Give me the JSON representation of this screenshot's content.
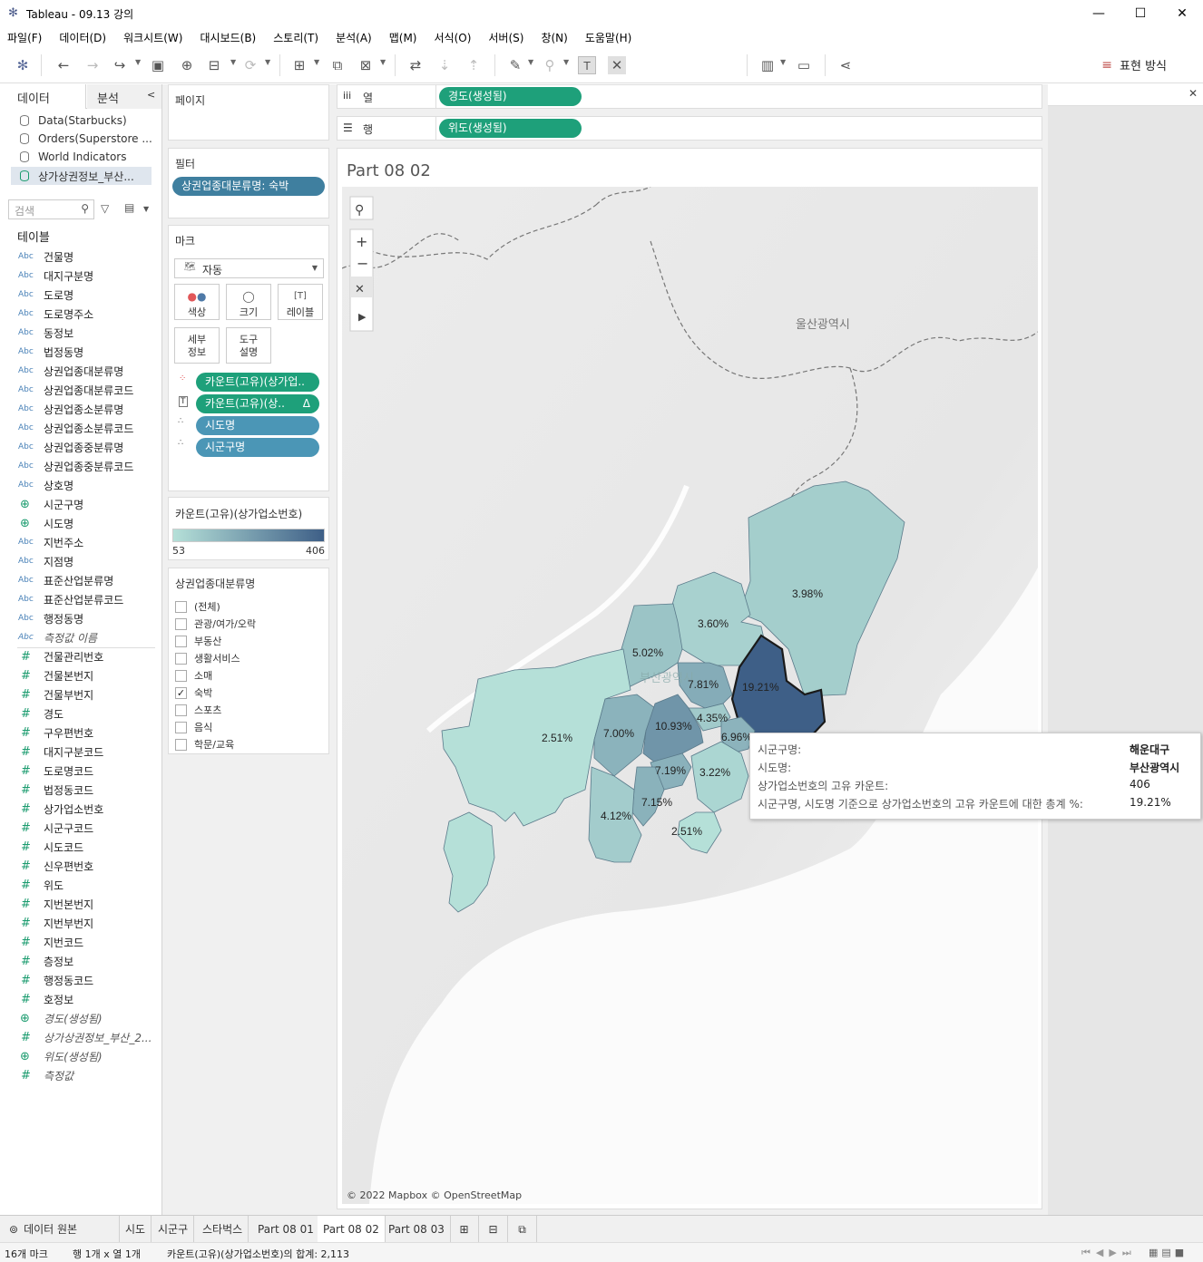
{
  "window": {
    "title": "Tableau - 09.13 강의"
  },
  "menu": [
    "파일(F)",
    "데이터(D)",
    "워크시트(W)",
    "대시보드(B)",
    "스토리(T)",
    "분석(A)",
    "맵(M)",
    "서식(O)",
    "서버(S)",
    "창(N)",
    "도움말(H)"
  ],
  "toolbar": {
    "show_me": "표현 방식"
  },
  "left_pane": {
    "tab_data": "데이터",
    "tab_analysis": "분석",
    "datasources": [
      "Data(Starbucks)",
      "Orders(Superstore ...",
      "World Indicators",
      "상가상권정보_부산..."
    ],
    "search_placeholder": "검색",
    "tables_label": "테이블",
    "fields": [
      {
        "type": "Abc",
        "name": "건물명"
      },
      {
        "type": "Abc",
        "name": "대지구분명"
      },
      {
        "type": "Abc",
        "name": "도로명"
      },
      {
        "type": "Abc",
        "name": "도로명주소"
      },
      {
        "type": "Abc",
        "name": "동정보"
      },
      {
        "type": "Abc",
        "name": "법정동명"
      },
      {
        "type": "Abc",
        "name": "상권업종대분류명"
      },
      {
        "type": "Abc",
        "name": "상권업종대분류코드"
      },
      {
        "type": "Abc",
        "name": "상권업종소분류명"
      },
      {
        "type": "Abc",
        "name": "상권업종소분류코드"
      },
      {
        "type": "Abc",
        "name": "상권업종중분류명"
      },
      {
        "type": "Abc",
        "name": "상권업종중분류코드"
      },
      {
        "type": "Abc",
        "name": "상호명"
      },
      {
        "type": "geo",
        "name": "시군구명"
      },
      {
        "type": "geo",
        "name": "시도명"
      },
      {
        "type": "Abc",
        "name": "지번주소"
      },
      {
        "type": "Abc",
        "name": "지점명"
      },
      {
        "type": "Abc",
        "name": "표준산업분류명"
      },
      {
        "type": "Abc",
        "name": "표준산업분류코드"
      },
      {
        "type": "Abc",
        "name": "행정동명"
      },
      {
        "type": "Abc",
        "name": "측정값 이름",
        "italic": true
      },
      {
        "type": "#",
        "name": "건물관리번호"
      },
      {
        "type": "#",
        "name": "건물본번지"
      },
      {
        "type": "#",
        "name": "건물부번지"
      },
      {
        "type": "#",
        "name": "경도"
      },
      {
        "type": "#",
        "name": "구우편번호"
      },
      {
        "type": "#",
        "name": "대지구분코드"
      },
      {
        "type": "#",
        "name": "도로명코드"
      },
      {
        "type": "#",
        "name": "법정동코드"
      },
      {
        "type": "#",
        "name": "상가업소번호"
      },
      {
        "type": "#",
        "name": "시군구코드"
      },
      {
        "type": "#",
        "name": "시도코드"
      },
      {
        "type": "#",
        "name": "신우편번호"
      },
      {
        "type": "#",
        "name": "위도"
      },
      {
        "type": "#",
        "name": "지번본번지"
      },
      {
        "type": "#",
        "name": "지번부번지"
      },
      {
        "type": "#",
        "name": "지번코드"
      },
      {
        "type": "#",
        "name": "층정보"
      },
      {
        "type": "#",
        "name": "행정동코드"
      },
      {
        "type": "#",
        "name": "호정보"
      },
      {
        "type": "geo",
        "name": "경도(생성됨)",
        "italic": true
      },
      {
        "type": "#",
        "name": "상가상권정보_부산_2...",
        "italic": true
      },
      {
        "type": "geo",
        "name": "위도(생성됨)",
        "italic": true
      },
      {
        "type": "#",
        "name": "측정값",
        "italic": true
      }
    ]
  },
  "cards": {
    "pages_title": "페이지",
    "filters_title": "필터",
    "filter_pill": "상권업종대분류명: 숙박",
    "marks_title": "마크",
    "mark_type": "자동",
    "mark_buttons": [
      "색상",
      "크기",
      "레이블",
      "세부\n정보",
      "도구\n설명"
    ],
    "mark_pills": [
      "카운트(고유)(상가업..",
      "카운트(고유)(상..",
      "시도명",
      "시군구명"
    ],
    "legend_title": "카운트(고유)(상가업소번호)",
    "legend_min": "53",
    "legend_max": "406",
    "legend_color_low": "#b5e0d8",
    "legend_color_high": "#3e5f87",
    "filter_card_title": "상권업종대분류명",
    "filter_options": [
      {
        "label": "(전체)",
        "checked": false
      },
      {
        "label": "관광/여가/오락",
        "checked": false
      },
      {
        "label": "부동산",
        "checked": false
      },
      {
        "label": "생활서비스",
        "checked": false
      },
      {
        "label": "소매",
        "checked": false
      },
      {
        "label": "숙박",
        "checked": true
      },
      {
        "label": "스포츠",
        "checked": false
      },
      {
        "label": "음식",
        "checked": false
      },
      {
        "label": "학문/교육",
        "checked": false
      }
    ]
  },
  "shelves": {
    "columns_label": "열",
    "rows_label": "행",
    "columns_pill": "경도(생성됨)",
    "rows_pill": "위도(생성됨)"
  },
  "view": {
    "title": "Part 08 02",
    "attribution": "© 2022 Mapbox © OpenStreetMap",
    "map_place_ulsan": "울산광역시",
    "map_place_busan": "부산광역시",
    "region_labels": [
      "3.98%",
      "3.60%",
      "5.02%",
      "19.21%",
      "7.81%",
      "2.51%",
      "7.00%",
      "10.93%",
      "4.35%",
      "6.96%",
      "7.19%",
      "3.22%",
      "7.15%",
      "4.12%",
      "2.51%"
    ]
  },
  "tooltip": {
    "rows": [
      {
        "label": "시군구명:",
        "value": "해운대구",
        "bold": true
      },
      {
        "label": "시도명:",
        "value": "부산광역시",
        "bold": true
      },
      {
        "label": "상가업소번호의 고유 카운트:",
        "value": "406",
        "bold": false
      },
      {
        "label": "시군구명, 시도명 기준으로 상가업소번호의 고유 카운트에 대한 총계 %:",
        "value": "19.21%",
        "bold": false
      }
    ]
  },
  "sheet_tabs": [
    "데이터 원본",
    "시도",
    "시군구",
    "스타벅스",
    "Part 08 01",
    "Part 08 02",
    "Part 08 03"
  ],
  "active_tab": "Part 08 02",
  "status": {
    "marks": "16개 마크",
    "dims": "행 1개 x 열 1개",
    "sum": "카운트(고유)(상가업소번호)의 합계: 2,113"
  }
}
